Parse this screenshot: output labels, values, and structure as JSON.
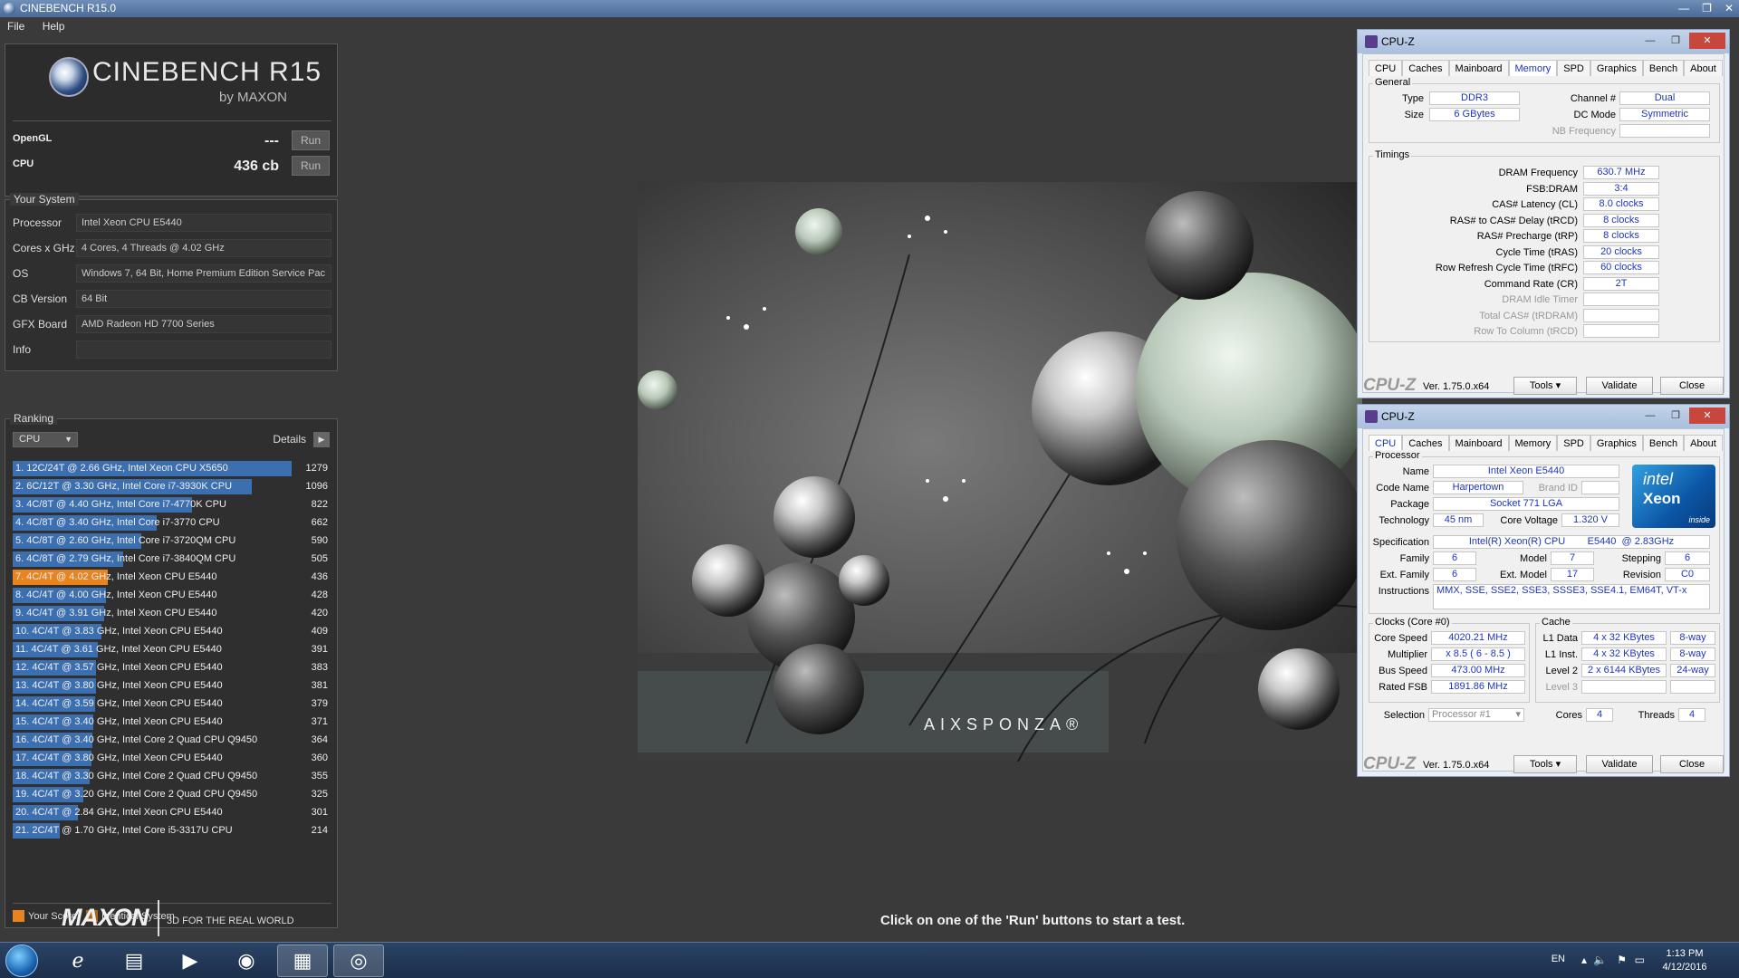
{
  "window": {
    "title": "CINEBENCH R15.0",
    "controls": [
      "—",
      "❐",
      "✕"
    ]
  },
  "menu": [
    "File",
    "Help"
  ],
  "logo": {
    "title": "CINEBENCH R15",
    "subtitle": "by MAXON"
  },
  "scores": [
    {
      "label": "OpenGL",
      "value": "---",
      "button": "Run"
    },
    {
      "label": "CPU",
      "value": "436 cb",
      "button": "Run"
    }
  ],
  "system": {
    "title": "Your System",
    "rows": [
      {
        "key": "Processor",
        "value": "Intel Xeon CPU E5440"
      },
      {
        "key": "Cores x GHz",
        "value": "4 Cores, 4 Threads @ 4.02 GHz"
      },
      {
        "key": "OS",
        "value": "Windows 7, 64 Bit, Home Premium Edition Service Pac"
      },
      {
        "key": "CB Version",
        "value": "64 Bit"
      },
      {
        "key": "GFX Board",
        "value": "AMD Radeon HD 7700 Series"
      },
      {
        "key": "Info",
        "value": ""
      }
    ]
  },
  "ranking": {
    "title": "Ranking",
    "select": "CPU",
    "details": "Details",
    "max": 1279,
    "rows": [
      {
        "text": "1. 12C/24T @ 2.66 GHz, Intel Xeon CPU X5650",
        "score": 1279,
        "kind": "normal"
      },
      {
        "text": "2. 6C/12T @ 3.30 GHz,  Intel Core i7-3930K CPU",
        "score": 1096,
        "kind": "normal"
      },
      {
        "text": "3. 4C/8T @ 4.40 GHz, Intel Core i7-4770K CPU",
        "score": 822,
        "kind": "normal"
      },
      {
        "text": "4. 4C/8T @ 3.40 GHz,  Intel Core i7-3770 CPU",
        "score": 662,
        "kind": "normal"
      },
      {
        "text": "5. 4C/8T @ 2.60 GHz, Intel Core i7-3720QM CPU",
        "score": 590,
        "kind": "normal"
      },
      {
        "text": "6. 4C/8T @ 2.79 GHz,  Intel Core i7-3840QM CPU",
        "score": 505,
        "kind": "normal"
      },
      {
        "text": "7. 4C/4T @ 4.02 GHz, Intel Xeon CPU E5440",
        "score": 436,
        "kind": "yours"
      },
      {
        "text": "8. 4C/4T @ 4.00 GHz, Intel Xeon CPU E5440",
        "score": 428,
        "kind": "normal"
      },
      {
        "text": "9. 4C/4T @ 3.91 GHz, Intel Xeon CPU E5440",
        "score": 420,
        "kind": "normal"
      },
      {
        "text": "10. 4C/4T @ 3.83 GHz, Intel Xeon CPU E5440",
        "score": 409,
        "kind": "normal"
      },
      {
        "text": "11. 4C/4T @ 3.61 GHz, Intel Xeon CPU E5440",
        "score": 391,
        "kind": "normal"
      },
      {
        "text": "12. 4C/4T @ 3.57 GHz, Intel Xeon CPU E5440",
        "score": 383,
        "kind": "normal"
      },
      {
        "text": "13. 4C/4T @ 3.80 GHz, Intel Xeon CPU E5440",
        "score": 381,
        "kind": "normal"
      },
      {
        "text": "14. 4C/4T @ 3.59 GHz, Intel Xeon CPU E5440",
        "score": 379,
        "kind": "normal"
      },
      {
        "text": "15. 4C/4T @ 3.40 GHz, Intel Xeon CPU E5440",
        "score": 371,
        "kind": "normal"
      },
      {
        "text": "16. 4C/4T @ 3.40 GHz, Intel Core 2 Quad CPU Q9450",
        "score": 364,
        "kind": "normal"
      },
      {
        "text": "17. 4C/4T @ 3.80 GHz, Intel Xeon CPU E5440",
        "score": 360,
        "kind": "normal"
      },
      {
        "text": "18. 4C/4T @ 3.30 GHz, Intel Core 2 Quad CPU Q9450",
        "score": 355,
        "kind": "normal"
      },
      {
        "text": "19. 4C/4T @ 3.20 GHz, Intel Core 2 Quad CPU Q9450",
        "score": 325,
        "kind": "normal"
      },
      {
        "text": "20. 4C/4T @ 2.84 GHz, Intel Xeon CPU E5440",
        "score": 301,
        "kind": "normal"
      },
      {
        "text": "21. 2C/4T @ 1.70 GHz,  Intel Core i5-3317U CPU",
        "score": 214,
        "kind": "normal"
      }
    ],
    "legend": [
      {
        "label": "Your Score",
        "color": "#e8841f"
      },
      {
        "label": "Identical System",
        "color": "#a8651c"
      }
    ],
    "colors": {
      "bar": "#3c6fb0",
      "yours": "#e8841f"
    }
  },
  "footer": {
    "brand": "MAXON",
    "tagline": "3D FOR THE REAL WORLD"
  },
  "render": {
    "credit": "AIXSPONZA®"
  },
  "status": "Click on one of the 'Run' buttons to start a test.",
  "cpuz_memory": {
    "title": "CPU-Z",
    "tabs": [
      "CPU",
      "Caches",
      "Mainboard",
      "Memory",
      "SPD",
      "Graphics",
      "Bench",
      "About"
    ],
    "active_tab": "Memory",
    "general_title": "General",
    "type_label": "Type",
    "type": "DDR3",
    "size_label": "Size",
    "size": "6 GBytes",
    "channel_label": "Channel #",
    "channel": "Dual",
    "dcmode_label": "DC Mode",
    "dcmode": "Symmetric",
    "nbfreq_label": "NB Frequency",
    "nbfreq": "",
    "timings_title": "Timings",
    "timings": [
      {
        "label": "DRAM Frequency",
        "value": "630.7 MHz",
        "dim": false
      },
      {
        "label": "FSB:DRAM",
        "value": "3:4",
        "dim": false
      },
      {
        "label": "CAS# Latency (CL)",
        "value": "8.0 clocks",
        "dim": false
      },
      {
        "label": "RAS# to CAS# Delay (tRCD)",
        "value": "8 clocks",
        "dim": false
      },
      {
        "label": "RAS# Precharge (tRP)",
        "value": "8 clocks",
        "dim": false
      },
      {
        "label": "Cycle Time (tRAS)",
        "value": "20 clocks",
        "dim": false
      },
      {
        "label": "Row Refresh Cycle Time (tRFC)",
        "value": "60 clocks",
        "dim": false
      },
      {
        "label": "Command Rate (CR)",
        "value": "2T",
        "dim": false
      },
      {
        "label": "DRAM Idle Timer",
        "value": "",
        "dim": true
      },
      {
        "label": "Total CAS# (tRDRAM)",
        "value": "",
        "dim": true
      },
      {
        "label": "Row To Column (tRCD)",
        "value": "",
        "dim": true
      }
    ],
    "brand": "CPU-Z",
    "version": "Ver. 1.75.0.x64",
    "tools": "Tools",
    "validate": "Validate",
    "close": "Close"
  },
  "cpuz_cpu": {
    "title": "CPU-Z",
    "tabs": [
      "CPU",
      "Caches",
      "Mainboard",
      "Memory",
      "SPD",
      "Graphics",
      "Bench",
      "About"
    ],
    "active_tab": "CPU",
    "processor_title": "Processor",
    "name_label": "Name",
    "name": "Intel Xeon E5440",
    "codename_label": "Code Name",
    "codename": "Harpertown",
    "brandid_label": "Brand ID",
    "package_label": "Package",
    "package": "Socket 771 LGA",
    "tech_label": "Technology",
    "tech": "45 nm",
    "voltage_label": "Core Voltage",
    "voltage": "1.320 V",
    "spec_label": "Specification",
    "spec": "Intel(R) Xeon(R) CPU        E5440  @ 2.83GHz",
    "family_label": "Family",
    "family": "6",
    "model_label": "Model",
    "model": "7",
    "stepping_label": "Stepping",
    "stepping": "6",
    "extfamily_label": "Ext. Family",
    "extfamily": "6",
    "extmodel_label": "Ext. Model",
    "extmodel": "17",
    "revision_label": "Revision",
    "revision": "C0",
    "instr_label": "Instructions",
    "instr": "MMX, SSE, SSE2, SSE3, SSSE3, SSE4.1, EM64T, VT-x",
    "intel_logo": {
      "line1": "intel",
      "line2": "Xeon",
      "line3": "inside"
    },
    "clocks_title": "Clocks (Core #0)",
    "corespeed_label": "Core Speed",
    "corespeed": "4020.21 MHz",
    "multiplier_label": "Multiplier",
    "multiplier": "x 8.5 ( 6 - 8.5 )",
    "busspeed_label": "Bus Speed",
    "busspeed": "473.00 MHz",
    "ratedfsb_label": "Rated FSB",
    "ratedfsb": "1891.86 MHz",
    "cache_title": "Cache",
    "l1d_label": "L1 Data",
    "l1d": "4 x 32 KBytes",
    "l1d_way": "8-way",
    "l1i_label": "L1 Inst.",
    "l1i": "4 x 32 KBytes",
    "l1i_way": "8-way",
    "l2_label": "Level 2",
    "l2": "2 x 6144 KBytes",
    "l2_way": "24-way",
    "l3_label": "Level 3",
    "selection_label": "Selection",
    "selection": "Processor #1",
    "cores_label": "Cores",
    "cores": "4",
    "threads_label": "Threads",
    "threads": "4",
    "brand": "CPU-Z",
    "version": "Ver. 1.75.0.x64",
    "tools": "Tools",
    "validate": "Validate",
    "close": "Close"
  },
  "taskbar": {
    "apps": [
      "start-orb",
      "internet-explorer-icon",
      "file-explorer-icon",
      "media-player-icon",
      "chrome-icon",
      "cpuz-icon",
      "cinebench-icon"
    ],
    "lang": "EN",
    "time": "1:13 PM",
    "date": "4/12/2016"
  }
}
